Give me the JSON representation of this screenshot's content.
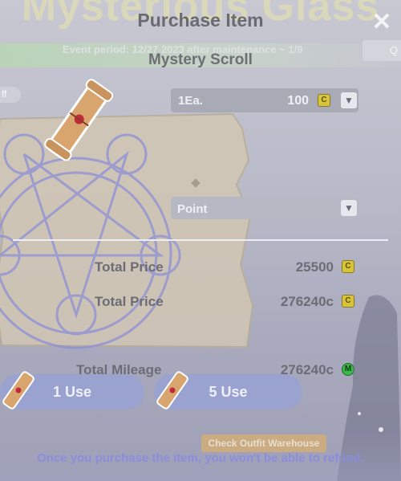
{
  "background_title": "Mysterious Glass",
  "header": {
    "title": "Purchase Item",
    "close_label": "✕"
  },
  "event_banner": {
    "text": "Event period: 12/27 2023 after maintenance ~ 1/9"
  },
  "right_chip": {
    "text": "Q"
  },
  "left_pill": {
    "text": "ff"
  },
  "item": {
    "name": "Mystery Scroll"
  },
  "quantity": {
    "unit_label": "1Ea.",
    "price": "100",
    "dropdown_icon": "caret-down"
  },
  "point_select": {
    "label": "Point",
    "dropdown_icon": "caret-down"
  },
  "totals": [
    {
      "label": "Total Price",
      "value": "25500",
      "currency_icon": "coin-icon"
    },
    {
      "label": "Total Price",
      "value": "276240c",
      "currency_icon": "coin-icon"
    },
    {
      "label": "Total Mileage",
      "value": "276240c",
      "currency_icon": "mileage-icon"
    }
  ],
  "buttons": {
    "use_one": "1 Use",
    "use_five": "5 Use",
    "warehouse": "Check Outfit Warehouse"
  },
  "notice": "Once you purchase the item, you won't be able to refund.",
  "colors": {
    "use_button": "#9aa3cf",
    "coin": "#d8c43a",
    "mileage": "#3bb84a",
    "notice": "#8b8ddc"
  }
}
